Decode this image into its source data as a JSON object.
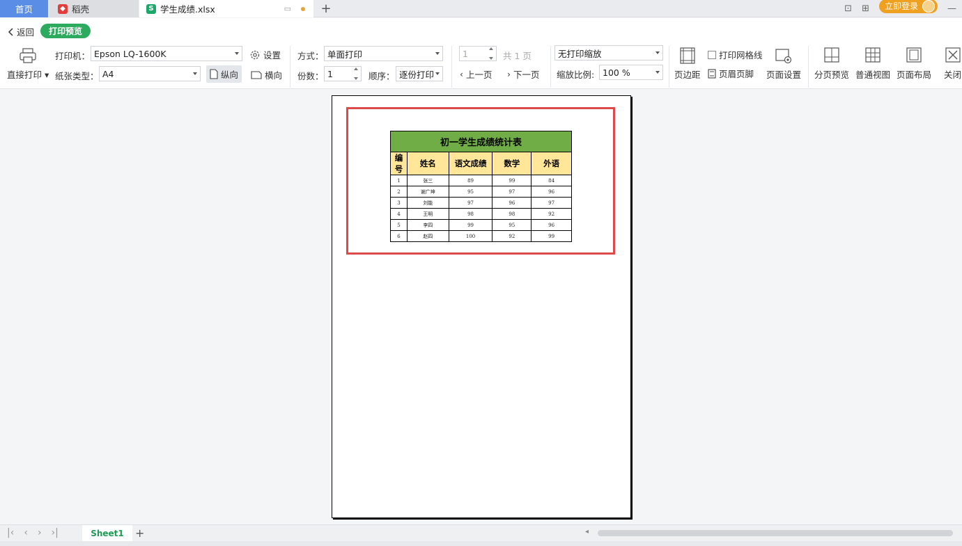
{
  "tabs": {
    "home": "首页",
    "daoke": "稻壳",
    "file": "学生成绩.xlsx"
  },
  "window": {
    "login": "立即登录"
  },
  "toolbar": {
    "back": "返回",
    "mode": "打印预览",
    "direct_print": "直接打印",
    "printer_label": "打印机：",
    "printer_value": "Epson LQ-1600K",
    "paper_label": "纸张类型：",
    "paper_value": "A4",
    "portrait": "纵向",
    "landscape": "横向",
    "settings": "设置",
    "method_label": "方式：",
    "method_value": "单面打印",
    "copies_label": "份数：",
    "copies_value": "1",
    "order_label": "顺序：",
    "order_value": "逐份打印",
    "page_value": "1",
    "total_pages": "共 1 页",
    "prev_page": "上一页",
    "next_page": "下一页",
    "scaling_value": "无打印缩放",
    "zoom_label": "缩放比例:",
    "zoom_value": "100 %",
    "margins": "页边距",
    "print_gridlines": "打印网格线",
    "header_footer": "页眉页脚",
    "page_setup": "页面设置",
    "page_break_preview": "分页预览",
    "normal_view": "普通视图",
    "page_layout": "页面布局",
    "close": "关闭"
  },
  "sheet": {
    "title": "初一学生成绩统计表",
    "headers": [
      "编号",
      "姓名",
      "语文成绩",
      "数学",
      "外语"
    ],
    "rows": [
      [
        "1",
        "张三",
        "89",
        "99",
        "84"
      ],
      [
        "2",
        "谢广坤",
        "95",
        "97",
        "96"
      ],
      [
        "3",
        "刘能",
        "97",
        "96",
        "97"
      ],
      [
        "4",
        "王明",
        "98",
        "98",
        "92"
      ],
      [
        "5",
        "李四",
        "99",
        "95",
        "96"
      ],
      [
        "6",
        "赵四",
        "100",
        "92",
        "99"
      ]
    ]
  },
  "sheetbar": {
    "sheet_name": "Sheet1"
  },
  "colors": {
    "accent_green": "#2cab5f",
    "title_fill": "#70ad47",
    "header_fill": "#ffe699",
    "print_area_border": "#de4a4a"
  }
}
